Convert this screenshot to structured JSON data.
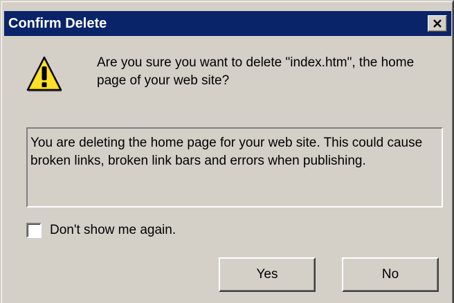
{
  "window": {
    "title": "Confirm Delete",
    "close_icon": "close-icon"
  },
  "message": {
    "text": "Are you sure you want to delete \"index.htm\", the home page of your web site?",
    "icon": "warning-icon"
  },
  "info": {
    "text": "You are deleting the home page for your web site. This could cause broken links, broken link bars and errors when publishing."
  },
  "option": {
    "label": "Don't show me again.",
    "checked": false
  },
  "buttons": {
    "yes": "Yes",
    "no": "No"
  },
  "colors": {
    "titlebar": "#0a246a",
    "face": "#d4d0c8",
    "warning_fill": "#ffd700"
  }
}
